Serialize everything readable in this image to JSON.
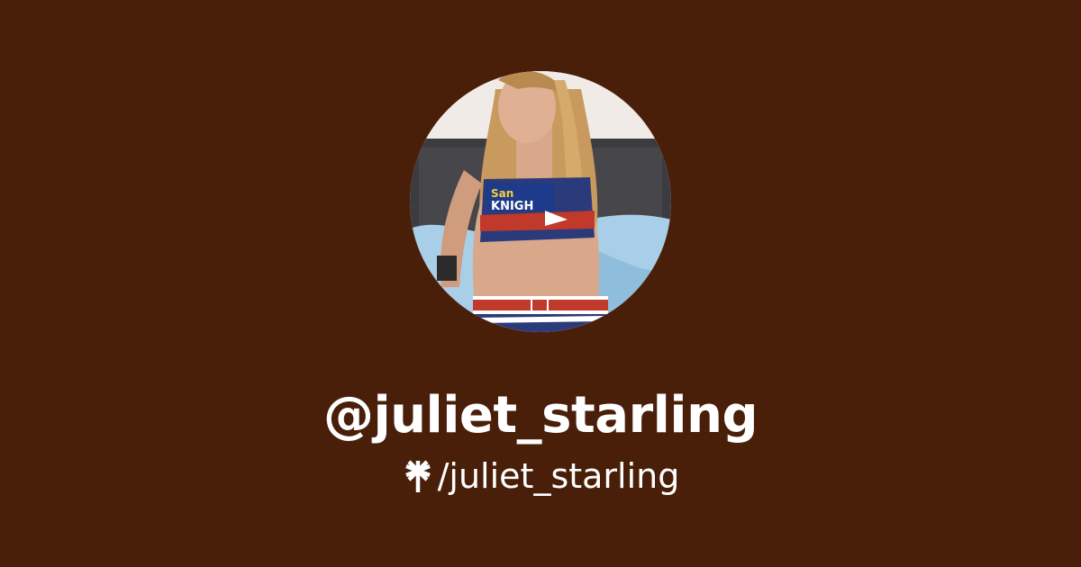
{
  "profile": {
    "handle": "@juliet_starling",
    "link_text": "/juliet_starling",
    "link_icon": "linktree-asterisk-icon",
    "avatar_alt": "profile photo"
  },
  "colors": {
    "background": "#4a1f0a",
    "text": "#ffffff"
  }
}
